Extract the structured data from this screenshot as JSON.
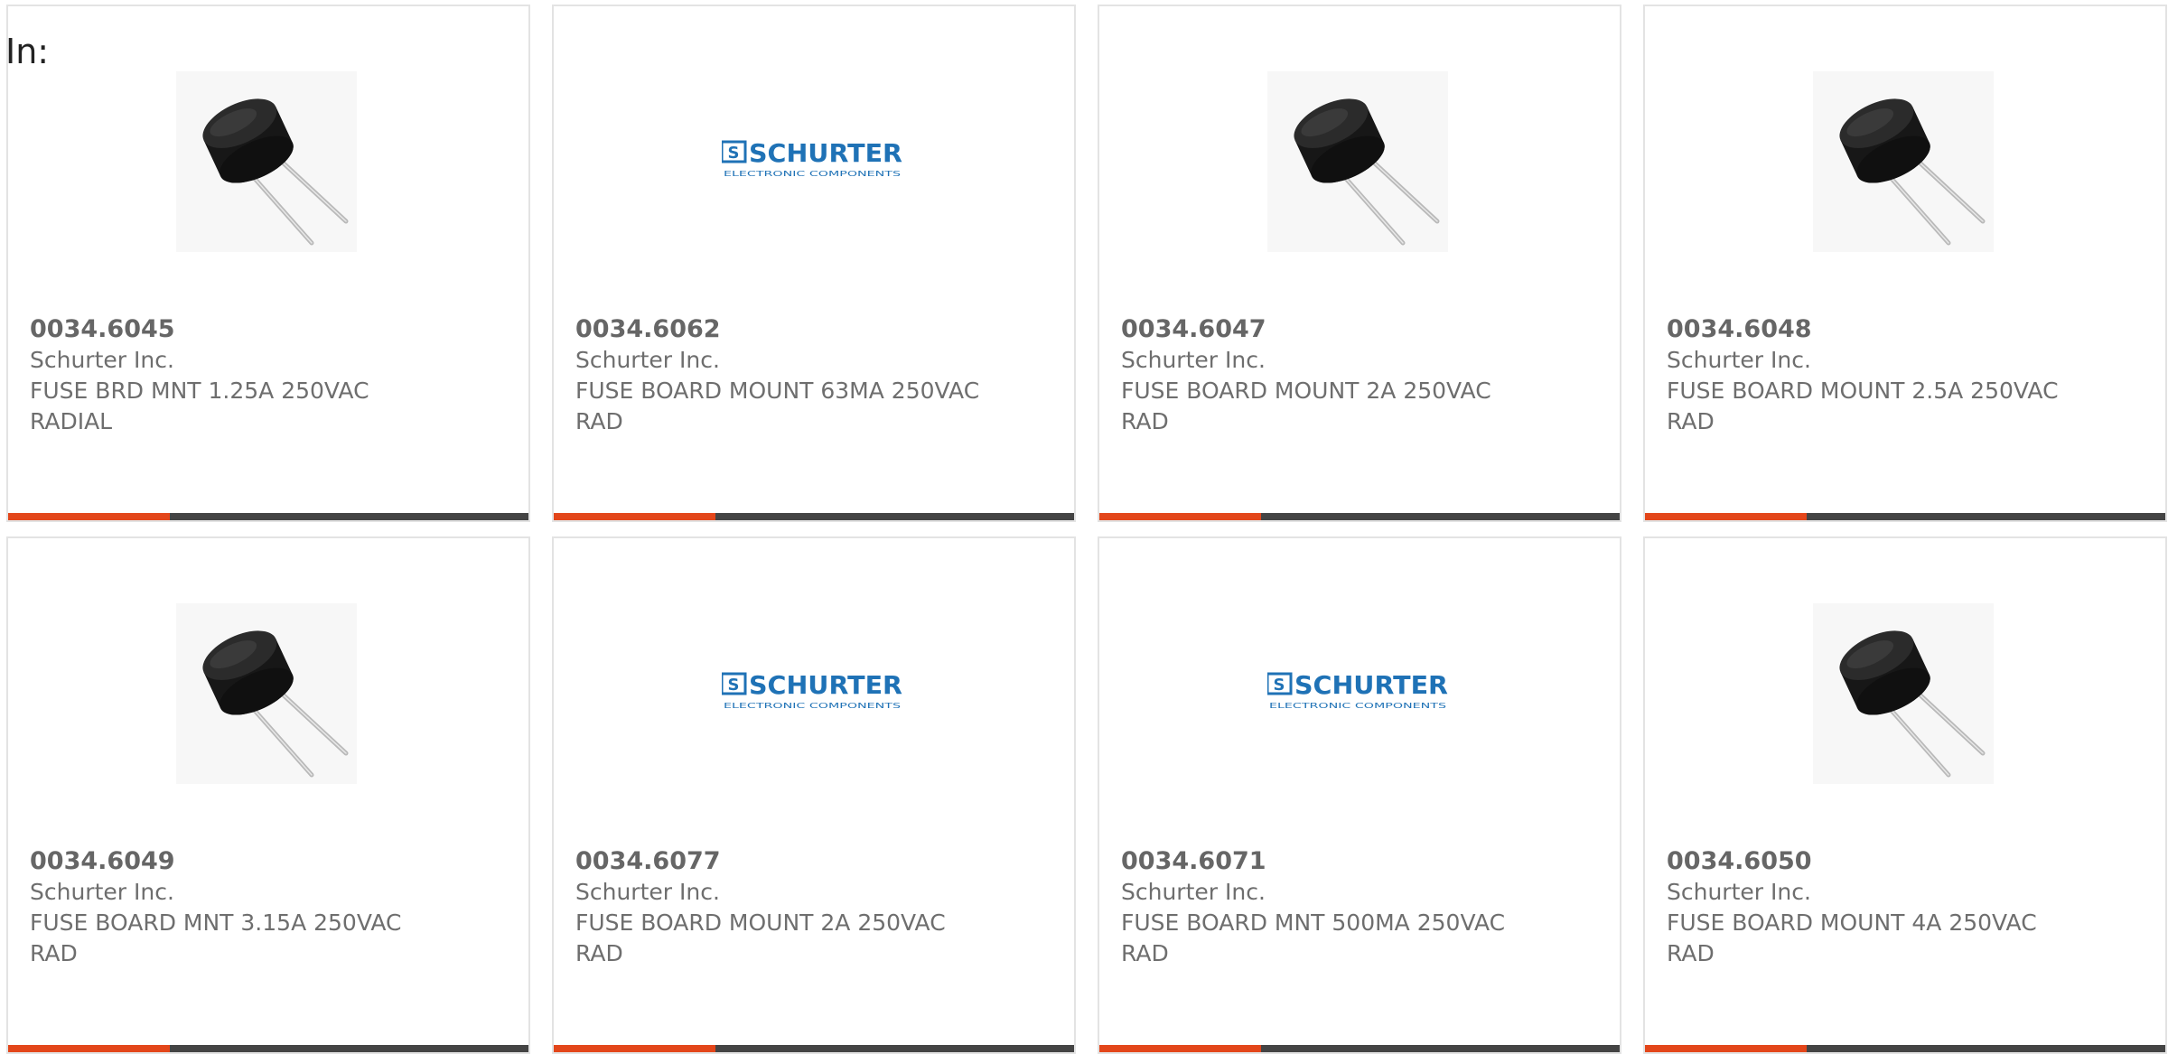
{
  "filter": {
    "label": "In:"
  },
  "colors": {
    "accent": "#e3461a",
    "bar": "#444444",
    "border": "#e3e3e3",
    "text": "#6e6e6e"
  },
  "products": [
    {
      "part_number": "0034.6045",
      "manufacturer": "Schurter Inc.",
      "description": "FUSE BRD MNT 1.25A 250VAC RADIAL",
      "image": "fuse-photo",
      "bar_fraction": 0.31
    },
    {
      "part_number": "0034.6062",
      "manufacturer": "Schurter Inc.",
      "description": "FUSE BOARD MOUNT 63MA 250VAC RAD",
      "image": "schurter-logo",
      "logo_text": "SCHURTER",
      "logo_subtext": "ELECTRONIC COMPONENTS",
      "bar_fraction": 0.31
    },
    {
      "part_number": "0034.6047",
      "manufacturer": "Schurter Inc.",
      "description": "FUSE BOARD MOUNT 2A 250VAC RAD",
      "image": "fuse-photo",
      "bar_fraction": 0.31
    },
    {
      "part_number": "0034.6048",
      "manufacturer": "Schurter Inc.",
      "description": "FUSE BOARD MOUNT 2.5A 250VAC RAD",
      "image": "fuse-photo",
      "bar_fraction": 0.31
    },
    {
      "part_number": "0034.6049",
      "manufacturer": "Schurter Inc.",
      "description": "FUSE BOARD MNT 3.15A 250VAC RAD",
      "image": "fuse-photo",
      "bar_fraction": 0.31
    },
    {
      "part_number": "0034.6077",
      "manufacturer": "Schurter Inc.",
      "description": "FUSE BOARD MOUNT 2A 250VAC RAD",
      "image": "schurter-logo",
      "logo_text": "SCHURTER",
      "logo_subtext": "ELECTRONIC COMPONENTS",
      "bar_fraction": 0.31
    },
    {
      "part_number": "0034.6071",
      "manufacturer": "Schurter Inc.",
      "description": "FUSE BOARD MNT 500MA 250VAC RAD",
      "image": "schurter-logo",
      "logo_text": "SCHURTER",
      "logo_subtext": "ELECTRONIC COMPONENTS",
      "bar_fraction": 0.31
    },
    {
      "part_number": "0034.6050",
      "manufacturer": "Schurter Inc.",
      "description": "FUSE BOARD MOUNT 4A 250VAC RAD",
      "image": "fuse-photo",
      "bar_fraction": 0.31
    }
  ]
}
